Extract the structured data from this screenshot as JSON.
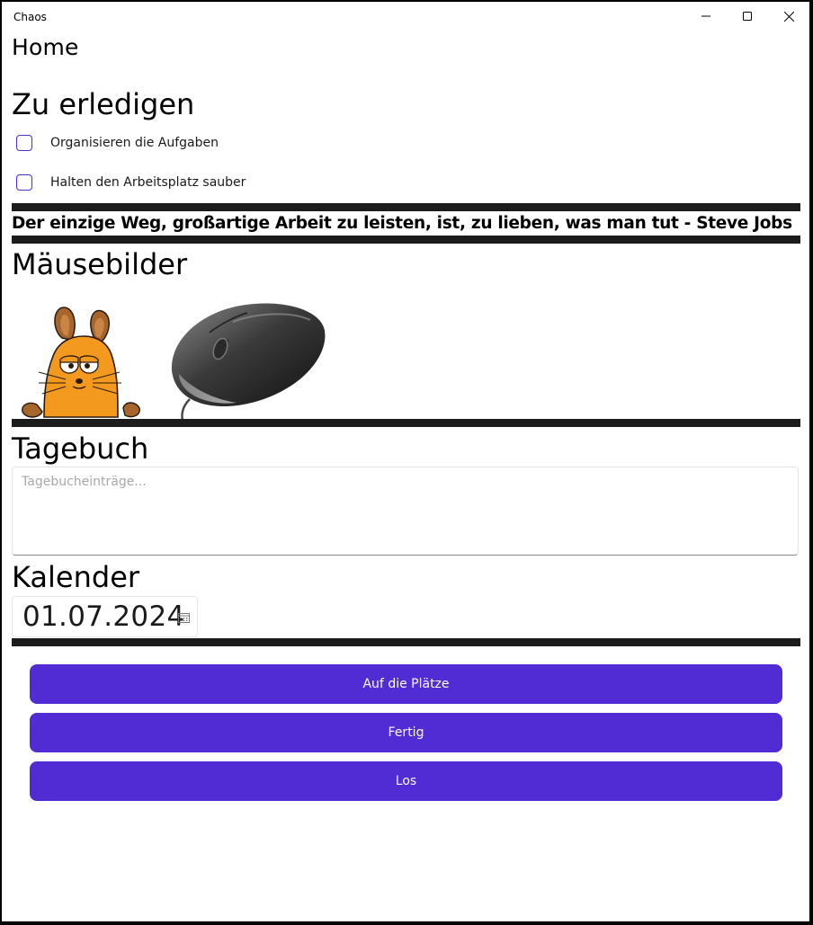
{
  "window": {
    "title": "Chaos",
    "minimize_icon": "minimize-icon",
    "maximize_icon": "maximize-icon",
    "close_icon": "close-icon"
  },
  "page": {
    "title": "Home"
  },
  "todo": {
    "heading": "Zu erledigen",
    "items": [
      {
        "label": "Organisieren die Aufgaben",
        "checked": false
      },
      {
        "label": "Halten den Arbeitsplatz sauber",
        "checked": false
      }
    ]
  },
  "quote": {
    "text": "Der einzige Weg, großartige Arbeit zu leisten, ist, zu lieben, was man tut - Steve Jobs"
  },
  "mouse_images": {
    "heading": "Mäusebilder",
    "images": [
      "cartoon-mouse-image",
      "computer-mouse-image"
    ]
  },
  "diary": {
    "heading": "Tagebuch",
    "placeholder": "Tagebucheinträge...",
    "value": ""
  },
  "calendar": {
    "heading": "Kalender",
    "date": "01.07.2024",
    "icon": "calendar-icon"
  },
  "buttons": {
    "places": "Auf die Plätze",
    "ready": "Fertig",
    "go": "Los"
  },
  "colors": {
    "accent": "#512bd4",
    "divider": "#1c1c1c",
    "background": "#ffffff"
  }
}
